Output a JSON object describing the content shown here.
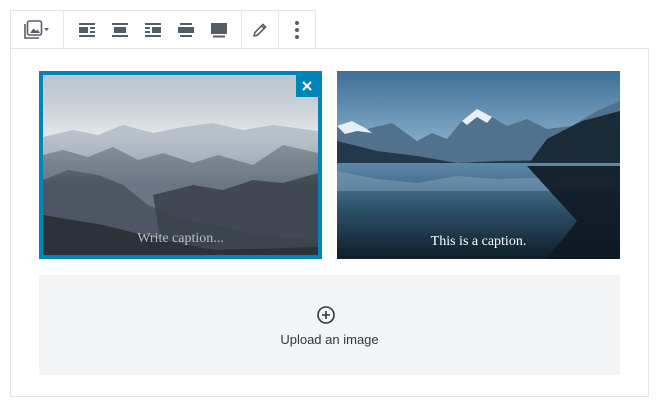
{
  "toolbar": {
    "groups": [
      {
        "name": "block-type",
        "items": [
          {
            "icon": "gallery-icon"
          },
          {
            "icon": "chevron-down-icon"
          }
        ]
      },
      {
        "name": "alignment",
        "items": [
          {
            "icon": "align-left-icon"
          },
          {
            "icon": "align-center-icon"
          },
          {
            "icon": "align-right-icon"
          },
          {
            "icon": "align-wide-icon"
          },
          {
            "icon": "align-full-icon"
          }
        ]
      },
      {
        "name": "edit",
        "items": [
          {
            "icon": "pencil-icon"
          }
        ]
      },
      {
        "name": "more",
        "items": [
          {
            "icon": "more-vertical-icon"
          }
        ]
      }
    ]
  },
  "gallery": {
    "images": [
      {
        "alt": "Misty mountain ridges",
        "caption": "",
        "caption_placeholder": "Write caption...",
        "selected": true
      },
      {
        "alt": "Mountain lake reflection",
        "caption": "This is a caption.",
        "selected": false
      }
    ],
    "remove_icon": "close-icon"
  },
  "upload": {
    "icon": "plus-circle-icon",
    "label": "Upload an image"
  },
  "colors": {
    "accent": "#0085ba",
    "border": "#e2e4e7",
    "icon": "#555d66",
    "upload_bg": "#f3f4f5"
  }
}
